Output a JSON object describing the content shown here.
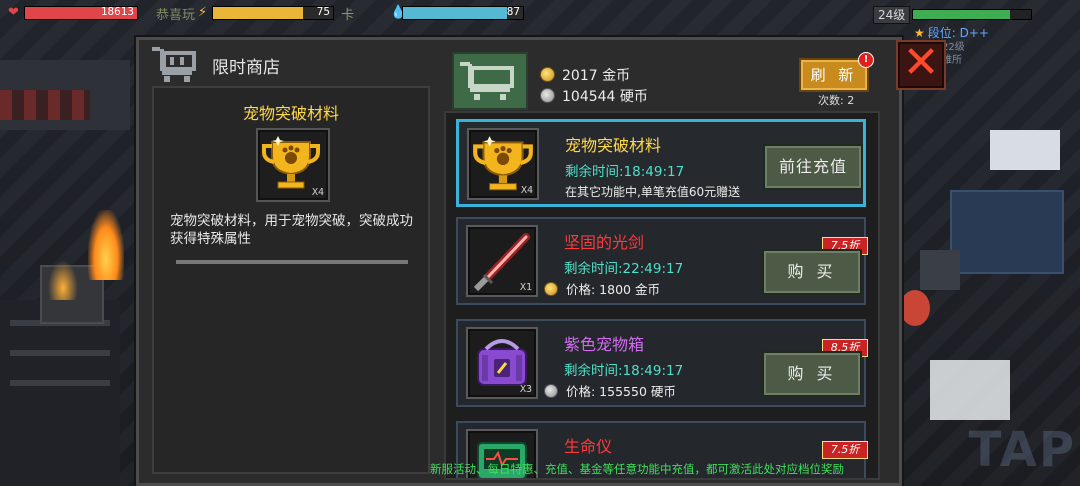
{
  "hud": {
    "hp_value": "18613",
    "stamina_value": "75",
    "mana_value": "87",
    "ticker_left": "恭喜玩",
    "ticker_right": "卡",
    "level": "24级",
    "rank": "段位: D++",
    "rank_hint_1": "达到22级",
    "rank_hint_2": "人避难所",
    "colors": {
      "hp": "#e0454a",
      "stamina": "#e9b638",
      "mana": "#56b9d4",
      "exp": "#3fae52"
    }
  },
  "shop": {
    "title": "限时商店",
    "close_icon": "close-icon",
    "gold": "2017 金币",
    "silver": "104544 硬币",
    "refresh_label": "刷 新",
    "refresh_alert": "!",
    "refresh_count": "次数: 2",
    "detail": {
      "name": "宠物突破材料",
      "qty": "X4",
      "description": "宠物突破材料，用于宠物突破，突破成功获得特殊属性"
    },
    "items": [
      {
        "name": "宠物突破材料",
        "name_color": "#ffd84a",
        "qty": "X4",
        "time": "剩余时间:18:49:17",
        "line3": "在其它功能中,单笔充值60元赠送",
        "button": "前往充值",
        "icon": "trophy-icon"
      },
      {
        "name": "坚固的光剑",
        "name_color": "#ff3a3a",
        "qty": "X1",
        "time": "剩余时间:22:49:17",
        "line3": "价格: 1800 金币",
        "currency": "gold",
        "button": "购 买",
        "discount": "7.5折",
        "icon": "lightsaber-icon"
      },
      {
        "name": "紫色宠物箱",
        "name_color": "#d36cf0",
        "qty": "X3",
        "time": "剩余时间:18:49:17",
        "line3": "价格: 155550 硬币",
        "currency": "silver",
        "button": "购 买",
        "discount": "8.5折",
        "icon": "pet-box-icon"
      },
      {
        "name": "生命仪",
        "name_color": "#ff3a3a",
        "discount": "7.5折",
        "icon": "life-device-icon"
      }
    ],
    "footer": "新服活动、每日特惠、充值、基金等任意功能中充值，都可激活此处对应档位奖励"
  }
}
